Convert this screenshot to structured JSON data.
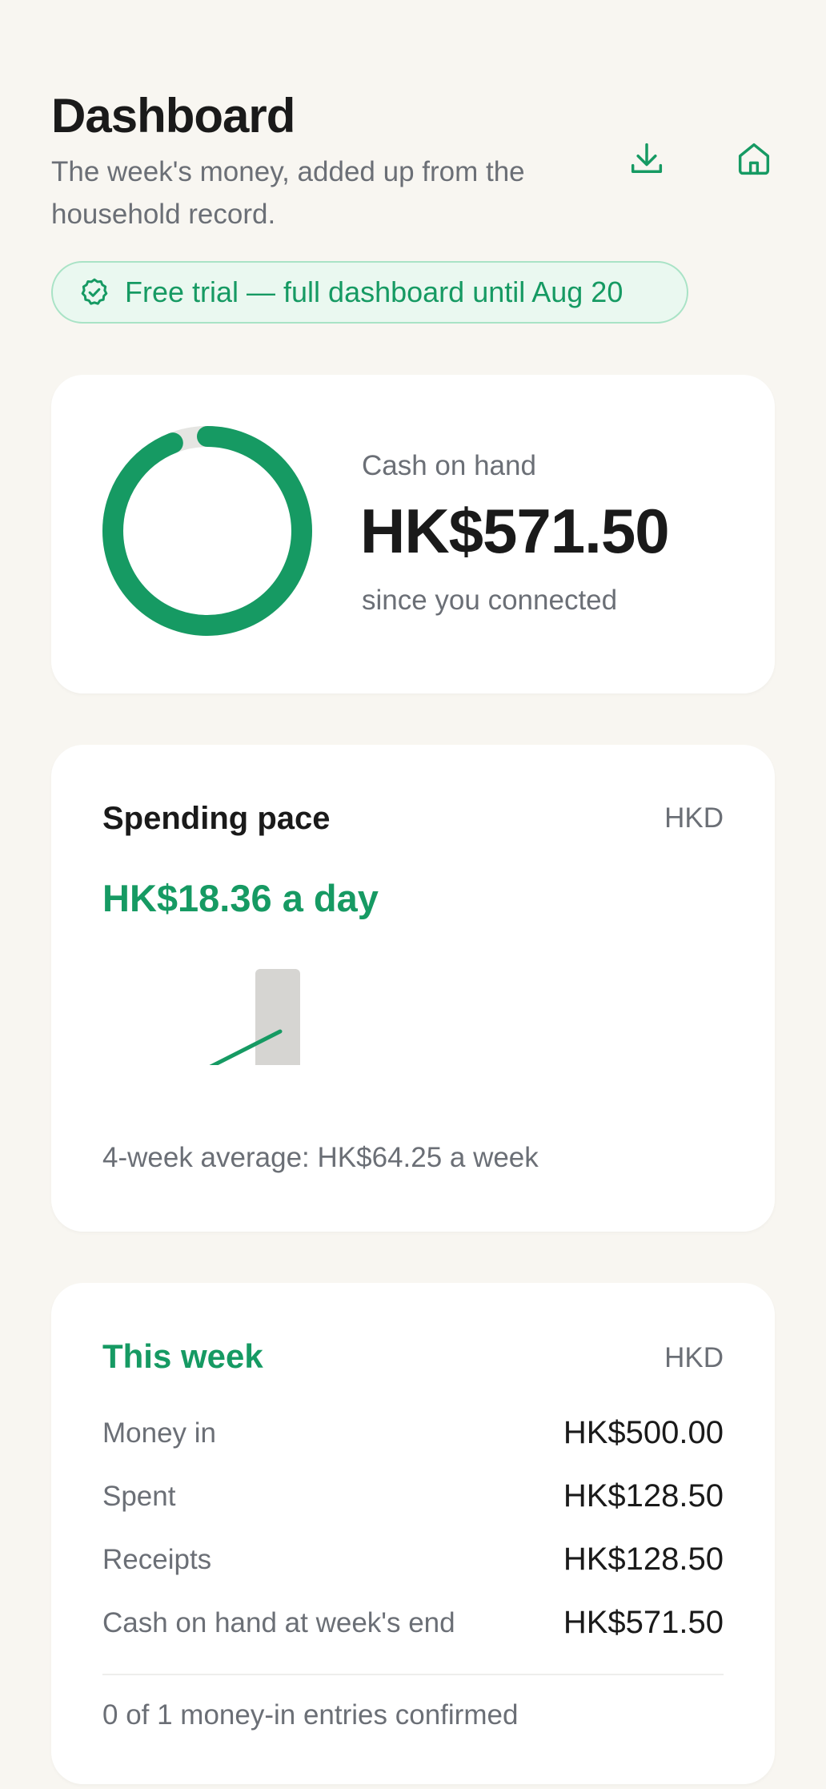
{
  "header": {
    "title": "Dashboard",
    "subtitle": "The week's money, added up from the household record.",
    "icons": [
      "download-icon",
      "home-icon"
    ]
  },
  "trial": {
    "text": "Free trial — full dashboard until Aug 20",
    "icon": "badge-check-icon"
  },
  "cash": {
    "label": "Cash on hand",
    "value": "HK$571.50",
    "sub": "since you connected",
    "ring_fraction": 0.94
  },
  "spending": {
    "title": "Spending pace",
    "currency": "HKD",
    "rate": "HK$18.36 a day",
    "average": "4-week average: HK$64.25 a week"
  },
  "this_week": {
    "title": "This week",
    "currency": "HKD",
    "rows": [
      {
        "label": "Money in",
        "value": "HK$500.00"
      },
      {
        "label": "Spent",
        "value": "HK$128.50"
      },
      {
        "label": "Receipts",
        "value": "HK$128.50"
      },
      {
        "label": "Cash on hand at week's end",
        "value": "HK$571.50"
      }
    ],
    "footer": "0 of 1 money-in entries confirmed"
  },
  "colors": {
    "accent": "#169a63",
    "background": "#f8f6f1",
    "muted_text": "#6b6f76",
    "ring_track": "#e5e5e2",
    "bar_gray": "#d6d5d2"
  }
}
